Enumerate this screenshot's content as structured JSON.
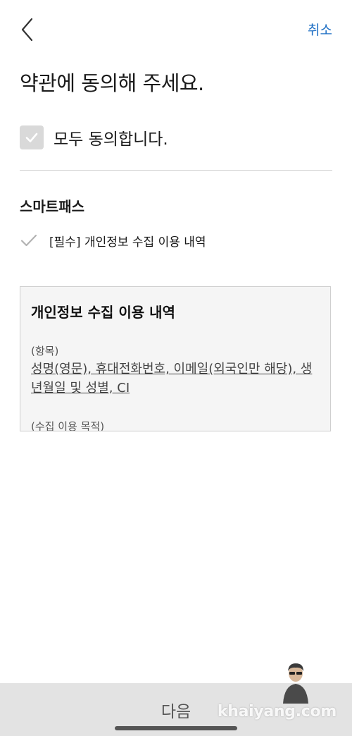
{
  "header": {
    "back_icon": "chevron-left-icon",
    "cancel_label": "취소"
  },
  "page_title": "약관에 동의해 주세요.",
  "agree_all": {
    "label": "모두 동의합니다.",
    "checked": false,
    "icon": "check-icon"
  },
  "section": {
    "title": "스마트패스",
    "terms": [
      {
        "label": "[필수] 개인정보 수집 이용 내역",
        "icon": "check-icon"
      }
    ]
  },
  "terms_box": {
    "title": "개인정보 수집 이용 내역",
    "items_heading": "(항목)",
    "items_text": "성명(영문), 휴대전화번호, 이메일(외국인만 해당), 생년월일 및 성별, CI",
    "purpose_heading": "(수집 이용 목적)"
  },
  "footer": {
    "next_label": "다음",
    "watermark": "khaiyang.com"
  },
  "colors": {
    "accent": "#1e6fc4",
    "checkbox_bg": "#d9d9d9",
    "bottom_bar": "#e3e3e3",
    "terms_box_bg": "#f5f5f5"
  }
}
